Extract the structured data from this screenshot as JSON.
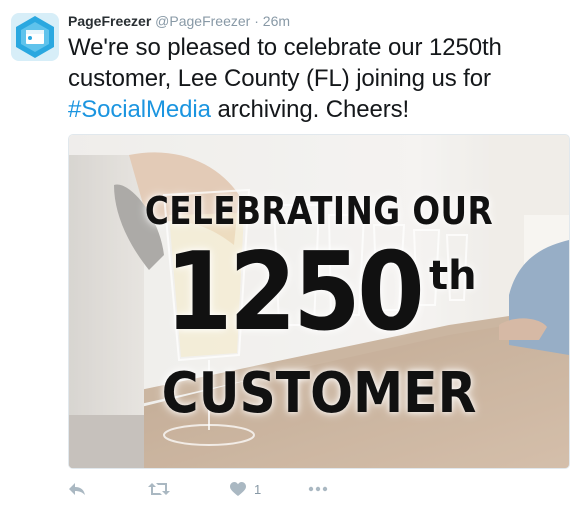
{
  "user": {
    "name": "PageFreezer",
    "handle": "@PageFreezer",
    "separator": "·",
    "time": "26m"
  },
  "tweet": {
    "text_part1": "We're so pleased to celebrate our 1250th customer, Lee County (FL) joining us for ",
    "hashtag": "#SocialMedia",
    "text_part2": " archiving. Cheers!"
  },
  "image": {
    "line1": "CELEBRATING OUR",
    "number": "1250",
    "suffix": "th",
    "line3": "CUSTOMER"
  },
  "actions": {
    "reply_icon": "reply-icon",
    "retweet_icon": "retweet-icon",
    "like_icon": "heart-icon",
    "like_count": "1",
    "more_icon": "more-icon"
  },
  "colors": {
    "link": "#1b95e0",
    "muted": "#8899a6",
    "text": "#14171a",
    "avatar_bg": "#2aa8e0"
  }
}
